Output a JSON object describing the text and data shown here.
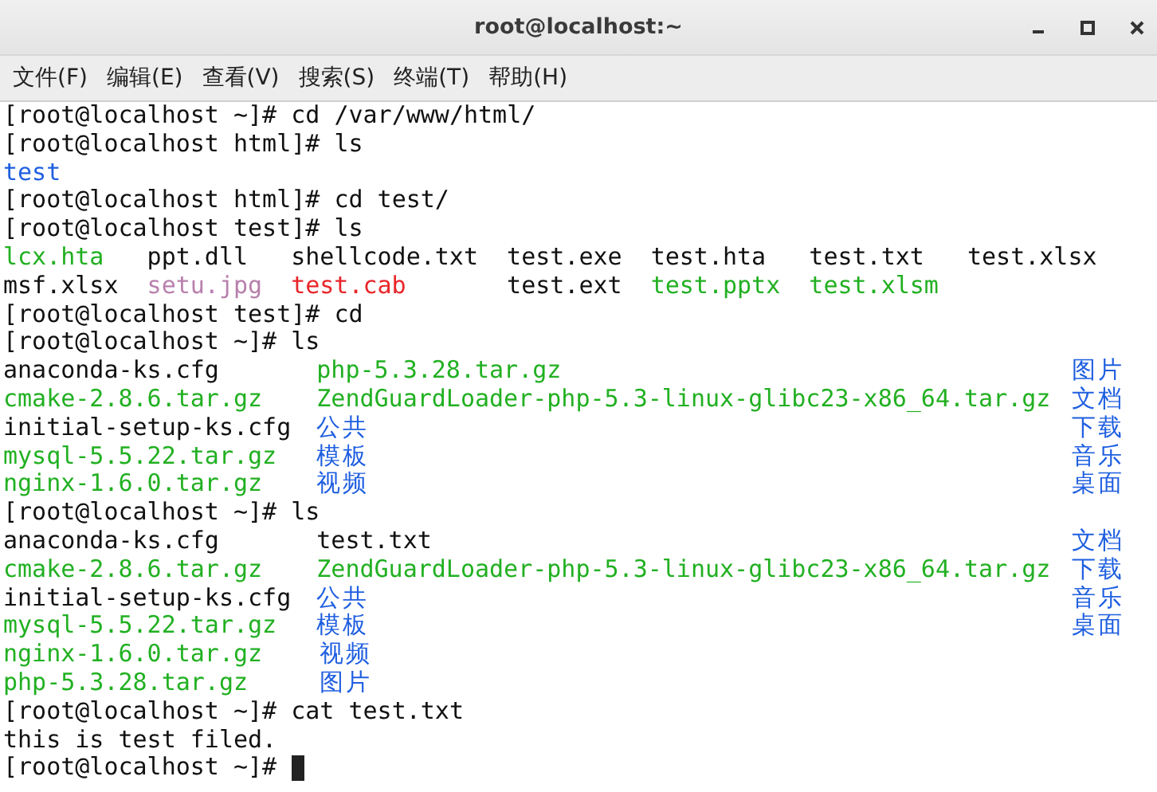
{
  "window": {
    "title": "root@localhost:~"
  },
  "menu": [
    "文件(F)",
    "编辑(E)",
    "查看(V)",
    "搜索(S)",
    "终端(T)",
    "帮助(H)"
  ],
  "terminal": {
    "lines": [
      {
        "kind": "prompt",
        "text": "[root@localhost ~]# cd /var/www/html/"
      },
      {
        "kind": "prompt",
        "text": "[root@localhost html]# ls"
      },
      {
        "kind": "listing",
        "rows": [
          [
            {
              "name": "test",
              "kind": "dir"
            }
          ]
        ]
      },
      {
        "kind": "prompt",
        "text": "[root@localhost html]# cd test/"
      },
      {
        "kind": "prompt",
        "text": "[root@localhost test]# ls"
      },
      {
        "kind": "listing",
        "rows": [
          [
            {
              "name": "lcx.hta",
              "kind": "exec"
            },
            {
              "name": "ppt.dll",
              "kind": "file"
            },
            {
              "name": "shellcode.txt",
              "kind": "file"
            },
            {
              "name": "test.exe",
              "kind": "file"
            },
            {
              "name": "test.hta",
              "kind": "file"
            },
            {
              "name": "test.txt",
              "kind": "file"
            },
            {
              "name": "test.xlsx",
              "kind": "file"
            }
          ],
          [
            {
              "name": "msf.xlsx",
              "kind": "file"
            },
            {
              "name": "setu.jpg",
              "kind": "image"
            },
            {
              "name": "test.cab",
              "kind": "archive"
            },
            {
              "name": "test.ext",
              "kind": "file"
            },
            {
              "name": "test.pptx",
              "kind": "exec"
            },
            {
              "name": "test.xlsm",
              "kind": "exec"
            }
          ]
        ]
      },
      {
        "kind": "prompt",
        "text": "[root@localhost test]# cd"
      },
      {
        "kind": "prompt",
        "text": "[root@localhost ~]# ls"
      },
      {
        "kind": "listing",
        "rows": [
          [
            {
              "name": "anaconda-ks.cfg",
              "kind": "file"
            },
            {
              "name": "php-5.3.28.tar.gz",
              "kind": "exec"
            },
            {
              "name": "图片",
              "kind": "dir"
            }
          ],
          [
            {
              "name": "cmake-2.8.6.tar.gz",
              "kind": "exec"
            },
            {
              "name": "ZendGuardLoader-php-5.3-linux-glibc23-x86_64.tar.gz",
              "kind": "exec"
            },
            {
              "name": "文档",
              "kind": "dir"
            }
          ],
          [
            {
              "name": "initial-setup-ks.cfg",
              "kind": "file"
            },
            {
              "name": "公共",
              "kind": "dir"
            },
            {
              "name": "下载",
              "kind": "dir"
            }
          ],
          [
            {
              "name": "mysql-5.5.22.tar.gz",
              "kind": "exec"
            },
            {
              "name": "模板",
              "kind": "dir"
            },
            {
              "name": "音乐",
              "kind": "dir"
            }
          ],
          [
            {
              "name": "nginx-1.6.0.tar.gz",
              "kind": "exec"
            },
            {
              "name": "视频",
              "kind": "dir"
            },
            {
              "name": "桌面",
              "kind": "dir"
            }
          ]
        ]
      },
      {
        "kind": "prompt",
        "text": "[root@localhost ~]# ls"
      },
      {
        "kind": "listing",
        "rows": [
          [
            {
              "name": "anaconda-ks.cfg",
              "kind": "file"
            },
            {
              "name": "test.txt",
              "kind": "file"
            },
            {
              "name": "文档",
              "kind": "dir"
            }
          ],
          [
            {
              "name": "cmake-2.8.6.tar.gz",
              "kind": "exec"
            },
            {
              "name": "ZendGuardLoader-php-5.3-linux-glibc23-x86_64.tar.gz",
              "kind": "exec"
            },
            {
              "name": "下载",
              "kind": "dir"
            }
          ],
          [
            {
              "name": "initial-setup-ks.cfg",
              "kind": "file"
            },
            {
              "name": "公共",
              "kind": "dir"
            },
            {
              "name": "音乐",
              "kind": "dir"
            }
          ],
          [
            {
              "name": "mysql-5.5.22.tar.gz",
              "kind": "exec"
            },
            {
              "name": "模板",
              "kind": "dir"
            },
            {
              "name": "桌面",
              "kind": "dir"
            }
          ],
          [
            {
              "name": "nginx-1.6.0.tar.gz",
              "kind": "exec"
            },
            {
              "name": "视频",
              "kind": "dir"
            }
          ],
          [
            {
              "name": "php-5.3.28.tar.gz",
              "kind": "exec"
            },
            {
              "name": "图片",
              "kind": "dir"
            }
          ]
        ]
      },
      {
        "kind": "prompt",
        "text": "[root@localhost ~]# cat test.txt"
      },
      {
        "kind": "output",
        "text": "this is test filed."
      },
      {
        "kind": "prompt",
        "text": "[root@localhost ~]#",
        "cursor": true
      }
    ]
  }
}
